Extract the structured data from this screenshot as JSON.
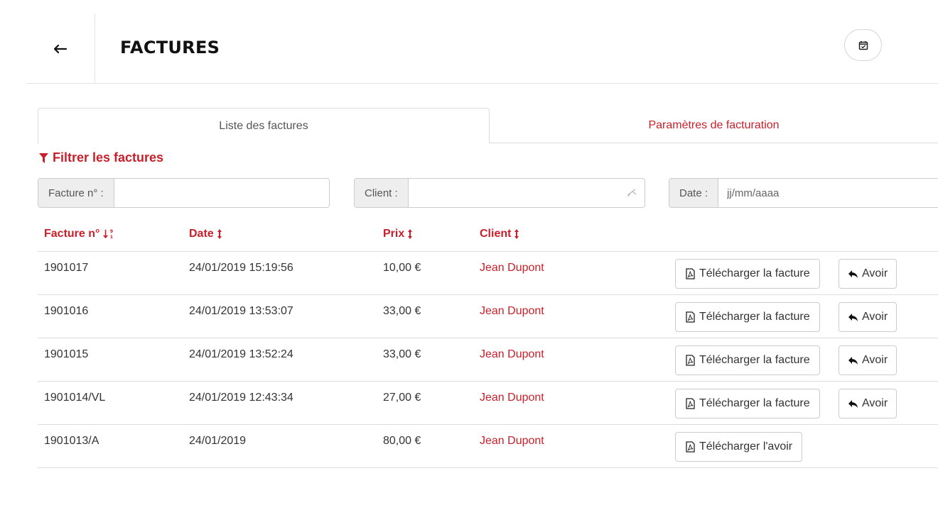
{
  "header": {
    "back_icon": "arrow-left-icon",
    "title": "FACTURES",
    "calendar_icon": "calendar-check-icon"
  },
  "tabs": [
    {
      "label": "Liste des factures",
      "active": true
    },
    {
      "label": "Paramètres de facturation",
      "active": false
    }
  ],
  "filter": {
    "title": "Filtrer les factures",
    "icon": "filter-icon",
    "facture": {
      "label": "Facture n° :",
      "value": "",
      "placeholder": ""
    },
    "client": {
      "label": "Client :",
      "value": "",
      "placeholder": ""
    },
    "date": {
      "label": "Date :",
      "value": "",
      "placeholder": "jj/mm/aaaa"
    }
  },
  "table": {
    "columns": [
      {
        "label": "Facture n°",
        "sort_icon": "sort-numeric-desc-icon"
      },
      {
        "label": "Date",
        "sort_icon": "sort-icon"
      },
      {
        "label": "Prix",
        "sort_icon": "sort-icon"
      },
      {
        "label": "Client",
        "sort_icon": "sort-icon"
      }
    ],
    "rows": [
      {
        "numero": "1901017",
        "date": "24/01/2019 15:19:56",
        "prix": "10,00 €",
        "client": "Jean Dupont",
        "download_label": "Télécharger la facture",
        "avoir_label": "Avoir"
      },
      {
        "numero": "1901016",
        "date": "24/01/2019 13:53:07",
        "prix": "33,00 €",
        "client": "Jean Dupont",
        "download_label": "Télécharger la facture",
        "avoir_label": "Avoir"
      },
      {
        "numero": "1901015",
        "date": "24/01/2019 13:52:24",
        "prix": "33,00 €",
        "client": "Jean Dupont",
        "download_label": "Télécharger la facture",
        "avoir_label": "Avoir"
      },
      {
        "numero": "1901014/VL",
        "date": "24/01/2019 12:43:34",
        "prix": "27,00 €",
        "client": "Jean Dupont",
        "download_label": "Télécharger la facture",
        "avoir_label": "Avoir"
      },
      {
        "numero": "1901013/A",
        "date": "24/01/2019",
        "prix": "80,00 €",
        "client": "Jean Dupont",
        "download_label": "Télécharger l'avoir",
        "avoir_label": null
      }
    ]
  },
  "colors": {
    "accent": "#c8202b",
    "border": "#dddddd",
    "addon_bg": "#eeeeee"
  }
}
